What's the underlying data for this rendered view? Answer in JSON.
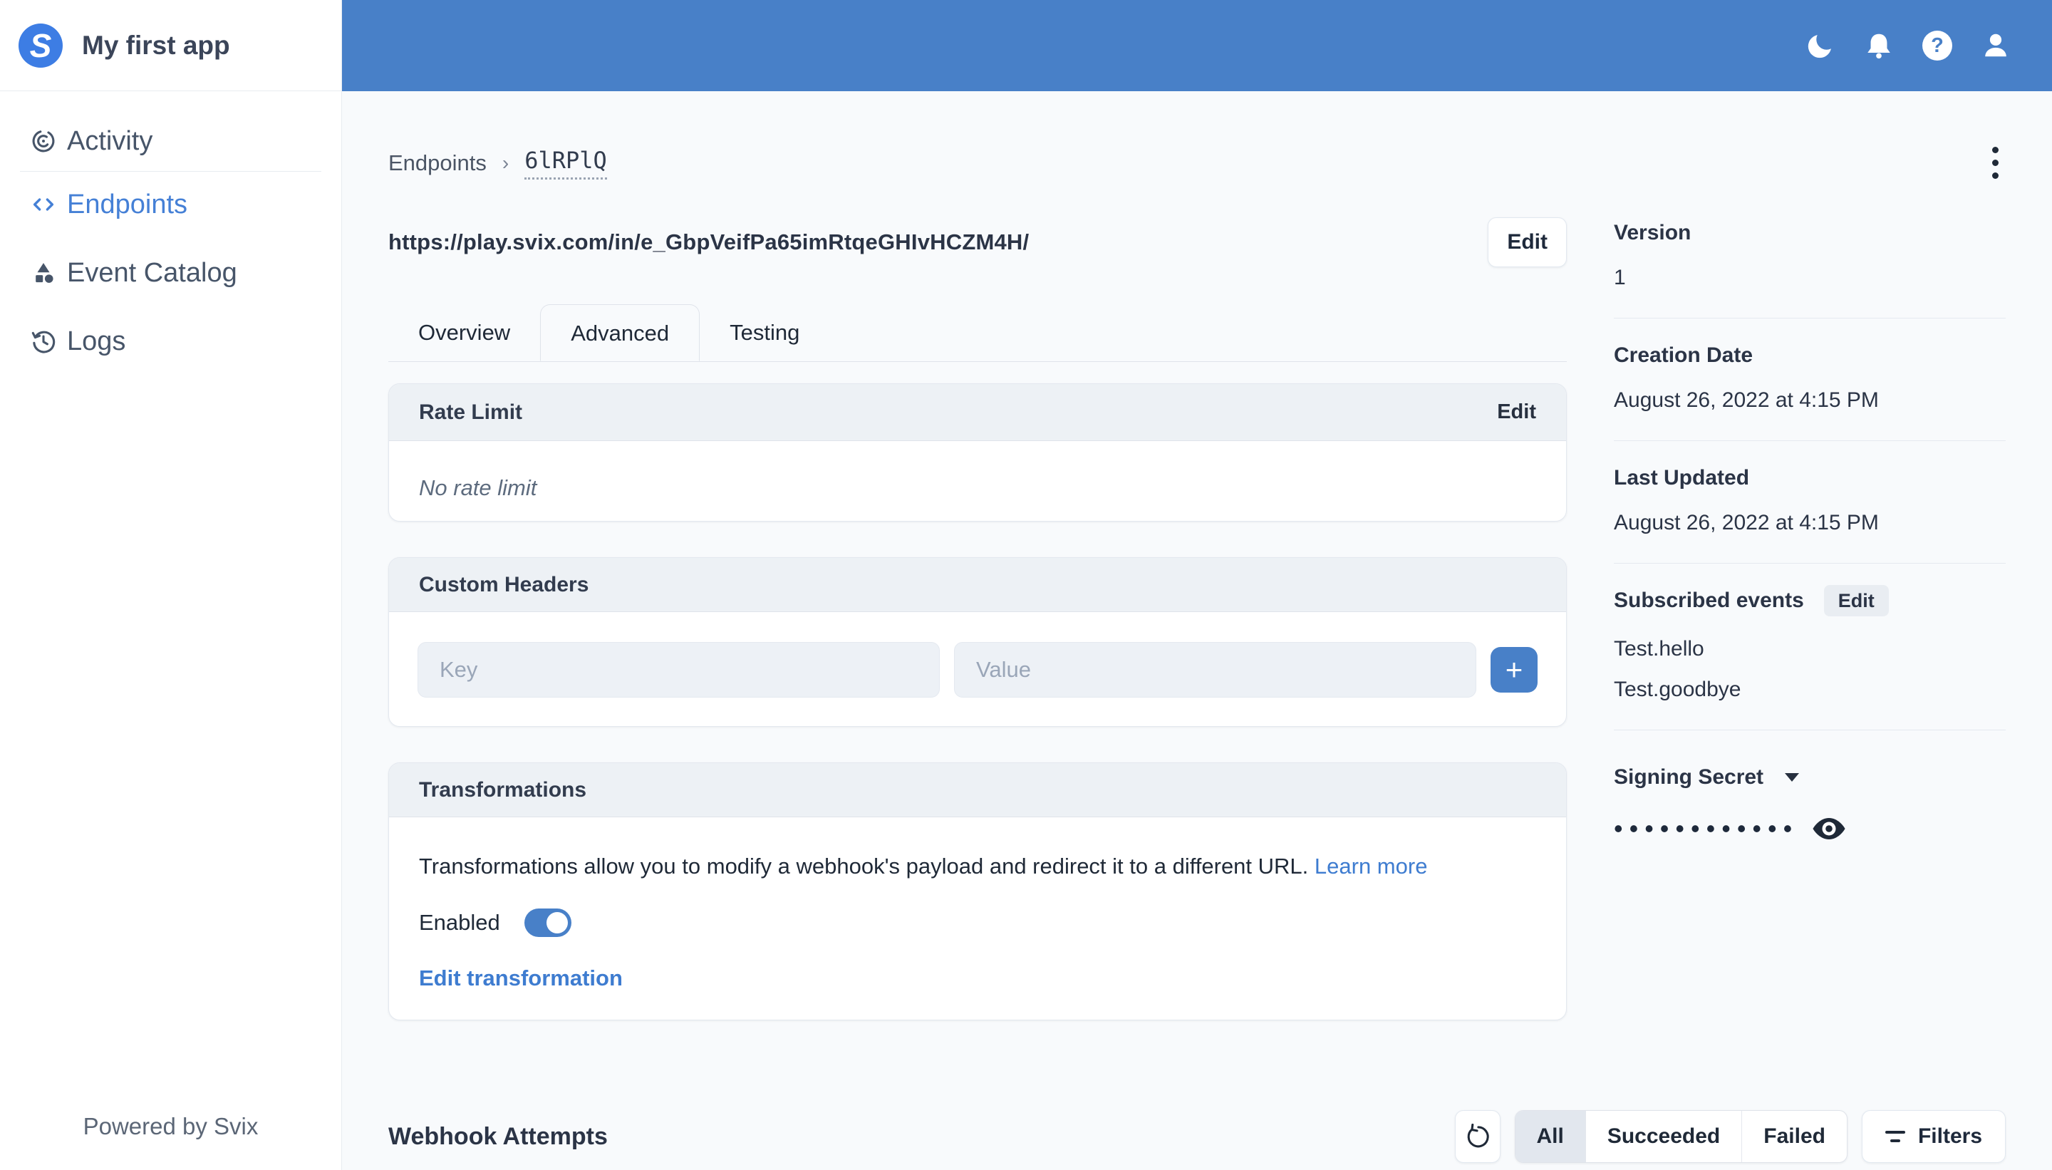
{
  "app": {
    "name": "My first app",
    "powered_by": "Powered by Svix",
    "logo_letter": "S"
  },
  "topbar": {
    "icons": [
      "moon",
      "bell",
      "help",
      "user"
    ],
    "help_glyph": "?"
  },
  "sidebar": {
    "items": [
      {
        "label": "Activity",
        "active": false
      },
      {
        "label": "Endpoints",
        "active": true
      },
      {
        "label": "Event Catalog",
        "active": false
      },
      {
        "label": "Logs",
        "active": false
      }
    ]
  },
  "breadcrumb": {
    "root": "Endpoints",
    "separator": "›",
    "current": "6lRPlQ"
  },
  "endpoint": {
    "url": "https://play.svix.com/in/e_GbpVeifPa65imRtqeGHIvHCZM4H/",
    "edit_label": "Edit"
  },
  "tabs": [
    {
      "label": "Overview",
      "active": false
    },
    {
      "label": "Advanced",
      "active": true
    },
    {
      "label": "Testing",
      "active": false
    }
  ],
  "cards": {
    "rate_limit": {
      "title": "Rate Limit",
      "action": "Edit",
      "empty_text": "No rate limit"
    },
    "custom_headers": {
      "title": "Custom Headers",
      "key_placeholder": "Key",
      "value_placeholder": "Value",
      "add_label": "+"
    },
    "transformations": {
      "title": "Transformations",
      "description": "Transformations allow you to modify a webhook's payload and redirect it to a different URL.",
      "learn_more": "Learn more",
      "enabled_label": "Enabled",
      "enabled": true,
      "edit_link": "Edit transformation"
    }
  },
  "details": {
    "version": {
      "label": "Version",
      "value": "1"
    },
    "creation_date": {
      "label": "Creation Date",
      "value": "August 26, 2022 at 4:15 PM"
    },
    "last_updated": {
      "label": "Last Updated",
      "value": "August 26, 2022 at 4:15 PM"
    },
    "subscribed_events": {
      "label": "Subscribed events",
      "action": "Edit",
      "events": [
        "Test.hello",
        "Test.goodbye"
      ]
    },
    "signing_secret": {
      "label": "Signing Secret",
      "masked_value": "••••••••••••"
    }
  },
  "attempts": {
    "title": "Webhook Attempts",
    "filters": [
      "All",
      "Succeeded",
      "Failed"
    ],
    "selected_filter": "All",
    "filters_label": "Filters"
  },
  "colors": {
    "topbar": "#4880c8",
    "accent_link": "#3e7cd0",
    "active_nav": "#4580d6",
    "logo": "#3d7de4"
  }
}
